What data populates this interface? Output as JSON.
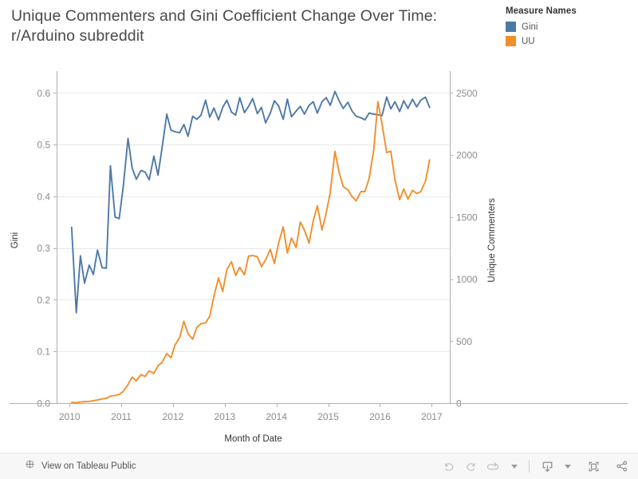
{
  "title": {
    "text": "Unique Commenters and Gini Coefficient Change Over Time:\nr/Arduino subreddit"
  },
  "legend": {
    "title": "Measure Names",
    "items": [
      {
        "label": "Gini",
        "color": "#4E79A7"
      },
      {
        "label": "UU",
        "color": "#F28E2B"
      }
    ]
  },
  "chart_data": {
    "type": "line",
    "title": "Unique Commenters and Gini Coefficient Change Over Time: r/Arduino subreddit",
    "xlabel": "Month of Date",
    "x_tick_labels": [
      "2010",
      "2011",
      "2012",
      "2013",
      "2014",
      "2015",
      "2016",
      "2017"
    ],
    "x_tick_values": [
      2010,
      2011,
      2012,
      2013,
      2014,
      2015,
      2016,
      2017
    ],
    "xlim": [
      2009.75,
      2017.35
    ],
    "grid": true,
    "legend_position": "top-right",
    "axes": [
      {
        "id": "left",
        "ylabel": "Gini",
        "ylim": [
          0.0,
          0.63
        ],
        "y_tick_labels": [
          "0.0",
          "0.1",
          "0.2",
          "0.3",
          "0.4",
          "0.5",
          "0.6"
        ],
        "y_tick_values": [
          0.0,
          0.1,
          0.2,
          0.3,
          0.4,
          0.5,
          0.6
        ]
      },
      {
        "id": "right",
        "ylabel": "Unique Commenters",
        "ylim": [
          0,
          2625
        ],
        "y_tick_labels": [
          "0",
          "500",
          "1000",
          "1500",
          "2000",
          "2500"
        ],
        "y_tick_values": [
          0,
          500,
          1000,
          1500,
          2000,
          2500
        ]
      }
    ],
    "series": [
      {
        "name": "Gini",
        "axis": "left",
        "color": "#4E79A7",
        "x": [
          2010.04,
          2010.13,
          2010.21,
          2010.29,
          2010.38,
          2010.46,
          2010.54,
          2010.63,
          2010.71,
          2010.79,
          2010.88,
          2010.96,
          2011.04,
          2011.13,
          2011.21,
          2011.29,
          2011.38,
          2011.46,
          2011.54,
          2011.63,
          2011.71,
          2011.79,
          2011.88,
          2011.96,
          2012.04,
          2012.13,
          2012.21,
          2012.29,
          2012.38,
          2012.46,
          2012.54,
          2012.63,
          2012.71,
          2012.79,
          2012.88,
          2012.96,
          2013.04,
          2013.13,
          2013.21,
          2013.29,
          2013.38,
          2013.46,
          2013.54,
          2013.63,
          2013.71,
          2013.79,
          2013.88,
          2013.96,
          2014.04,
          2014.13,
          2014.21,
          2014.29,
          2014.38,
          2014.46,
          2014.54,
          2014.63,
          2014.71,
          2014.79,
          2014.88,
          2014.96,
          2015.04,
          2015.13,
          2015.21,
          2015.29,
          2015.38,
          2015.46,
          2015.54,
          2015.63,
          2015.71,
          2015.79,
          2015.88,
          2015.96,
          2016.04,
          2016.13,
          2016.21,
          2016.29,
          2016.38,
          2016.46,
          2016.54,
          2016.63,
          2016.71,
          2016.79,
          2016.88,
          2016.96
        ],
        "values": [
          0.34,
          0.175,
          0.285,
          0.232,
          0.267,
          0.249,
          0.296,
          0.262,
          0.261,
          0.459,
          0.36,
          0.357,
          0.421,
          0.512,
          0.455,
          0.433,
          0.45,
          0.447,
          0.432,
          0.478,
          0.441,
          0.495,
          0.559,
          0.528,
          0.525,
          0.523,
          0.539,
          0.516,
          0.555,
          0.549,
          0.557,
          0.586,
          0.553,
          0.571,
          0.548,
          0.572,
          0.586,
          0.563,
          0.557,
          0.591,
          0.562,
          0.574,
          0.589,
          0.56,
          0.572,
          0.542,
          0.561,
          0.585,
          0.575,
          0.549,
          0.588,
          0.554,
          0.565,
          0.574,
          0.559,
          0.576,
          0.583,
          0.561,
          0.583,
          0.591,
          0.576,
          0.603,
          0.585,
          0.57,
          0.582,
          0.565,
          0.555,
          0.552,
          0.548,
          0.561,
          0.559,
          0.558,
          0.556,
          0.592,
          0.569,
          0.583,
          0.564,
          0.585,
          0.57,
          0.588,
          0.573,
          0.586,
          0.592,
          0.572
        ]
      },
      {
        "name": "UU",
        "axis": "right",
        "color": "#F28E2B",
        "x": [
          2010.04,
          2010.13,
          2010.21,
          2010.29,
          2010.38,
          2010.46,
          2010.54,
          2010.63,
          2010.71,
          2010.79,
          2010.88,
          2010.96,
          2011.04,
          2011.13,
          2011.21,
          2011.29,
          2011.38,
          2011.46,
          2011.54,
          2011.63,
          2011.71,
          2011.79,
          2011.88,
          2011.96,
          2012.04,
          2012.13,
          2012.21,
          2012.29,
          2012.38,
          2012.46,
          2012.54,
          2012.63,
          2012.71,
          2012.79,
          2012.88,
          2012.96,
          2013.04,
          2013.13,
          2013.21,
          2013.29,
          2013.38,
          2013.46,
          2013.54,
          2013.63,
          2013.71,
          2013.79,
          2013.88,
          2013.96,
          2014.04,
          2014.13,
          2014.21,
          2014.29,
          2014.38,
          2014.46,
          2014.54,
          2014.63,
          2014.71,
          2014.79,
          2014.88,
          2014.96,
          2015.04,
          2015.13,
          2015.21,
          2015.29,
          2015.38,
          2015.46,
          2015.54,
          2015.63,
          2015.71,
          2015.79,
          2015.88,
          2015.96,
          2016.04,
          2016.13,
          2016.21,
          2016.29,
          2016.38,
          2016.46,
          2016.54,
          2016.63,
          2016.71,
          2016.79,
          2016.88,
          2016.96
        ],
        "values": [
          6,
          4,
          9,
          12,
          14,
          20,
          26,
          34,
          40,
          56,
          62,
          70,
          95,
          150,
          210,
          180,
          230,
          215,
          260,
          240,
          300,
          330,
          400,
          365,
          470,
          530,
          660,
          560,
          515,
          610,
          640,
          648,
          700,
          860,
          1010,
          900,
          1075,
          1140,
          1030,
          1095,
          1035,
          1185,
          1190,
          1180,
          1100,
          1155,
          1240,
          1125,
          1290,
          1420,
          1210,
          1330,
          1255,
          1460,
          1395,
          1290,
          1470,
          1590,
          1395,
          1530,
          1700,
          2030,
          1860,
          1745,
          1720,
          1665,
          1630,
          1705,
          1705,
          1810,
          2040,
          2430,
          2250,
          2020,
          2030,
          1800,
          1640,
          1725,
          1645,
          1715,
          1690,
          1705,
          1790,
          1960
        ]
      }
    ]
  },
  "toolbar": {
    "tableau_link_label": "View on Tableau Public",
    "share_label": "Share",
    "buttons": [
      {
        "name": "undo",
        "label": "Undo"
      },
      {
        "name": "redo",
        "label": "Redo"
      },
      {
        "name": "revert",
        "label": "Revert"
      },
      {
        "name": "download",
        "label": "Download"
      },
      {
        "name": "fullscreen",
        "label": "Full Screen"
      }
    ]
  }
}
